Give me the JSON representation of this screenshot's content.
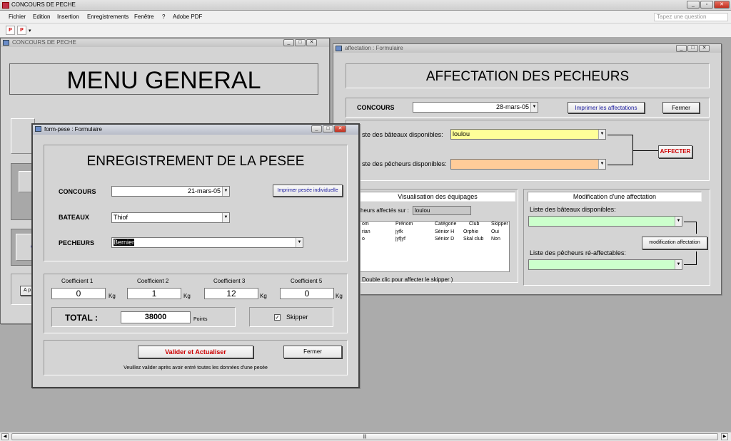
{
  "app": {
    "title": "CONCOURS DE PECHE"
  },
  "menu": {
    "items": [
      "Fichier",
      "Edition",
      "Insertion",
      "Enregistrements",
      "Fenêtre",
      "?",
      "Adobe PDF"
    ],
    "ask_placeholder": "Tapez une question"
  },
  "menu_general": {
    "window_title": "CONCOURS DE PECHE",
    "heading": "MENU GENERAL",
    "partial_label": "A p"
  },
  "affectation": {
    "window_title": "affectation : Formulaire",
    "heading": "AFFECTATION DES PECHEURS",
    "concours_label": "CONCOURS",
    "concours_value": "28-mars-05",
    "print_button": "Imprimer les affectations",
    "close_button": "Fermer",
    "boats_label": "ste des bâteaux disponibles:",
    "boats_value": "loulou",
    "fishers_label": "ste des pêcheurs disponibles:",
    "fishers_value": "",
    "affecter_button": "AFFECTER",
    "visu_title": "Visualisation des équipages",
    "affected_label": "cheurs affectés sur :",
    "affected_value": "loulou",
    "columns": [
      "om",
      "Prénom",
      "Catégorie",
      "Club",
      "Skipper"
    ],
    "rows": [
      [
        "rian",
        "jyfk",
        "Sénior H",
        "Orphie",
        "Oui"
      ],
      [
        "o",
        "jyfjyf",
        "Sénior D",
        "Skal club",
        "Non"
      ]
    ],
    "hint": "Double clic pour affecter le skipper )",
    "modif_title": "Modification d'une affectation",
    "modif_boats_label": "Liste des bâteaux disponibles:",
    "modif_button": "modification affectation",
    "modif_fishers_label": "Liste des pêcheurs ré-affectables:"
  },
  "pese": {
    "window_title": "form-pese : Formulaire",
    "heading": "ENREGISTREMENT DE LA PESEE",
    "concours_label": "CONCOURS",
    "concours_value": "21-mars-05",
    "print_button": "Imprimer pesée individuelle",
    "bateaux_label": "BATEAUX",
    "bateaux_value": "Thiof",
    "pecheurs_label": "PECHEURS",
    "pecheurs_value": "Bernier",
    "coef_labels": [
      "Coefficient 1",
      "Coefficient 2",
      "Coefficient 3",
      "Coefficient 5"
    ],
    "coef_values": [
      "0",
      "1",
      "12",
      "0"
    ],
    "unit": "Kg",
    "total_label": "TOTAL :",
    "total_value": "38000",
    "points_label": "Points",
    "skipper_label": "Skipper",
    "validate_button": "Valider et Actualiser",
    "close_button": "Fermer",
    "footer_note": "Veuillez valider après avoir entré toutes les données d'une pesée"
  },
  "colors": {
    "yellow_field": "#ffff99",
    "orange_field": "#ffcc99",
    "green_field": "#ccffcc",
    "red_text": "#cc0000",
    "link_blue": "#1a1aa0"
  }
}
